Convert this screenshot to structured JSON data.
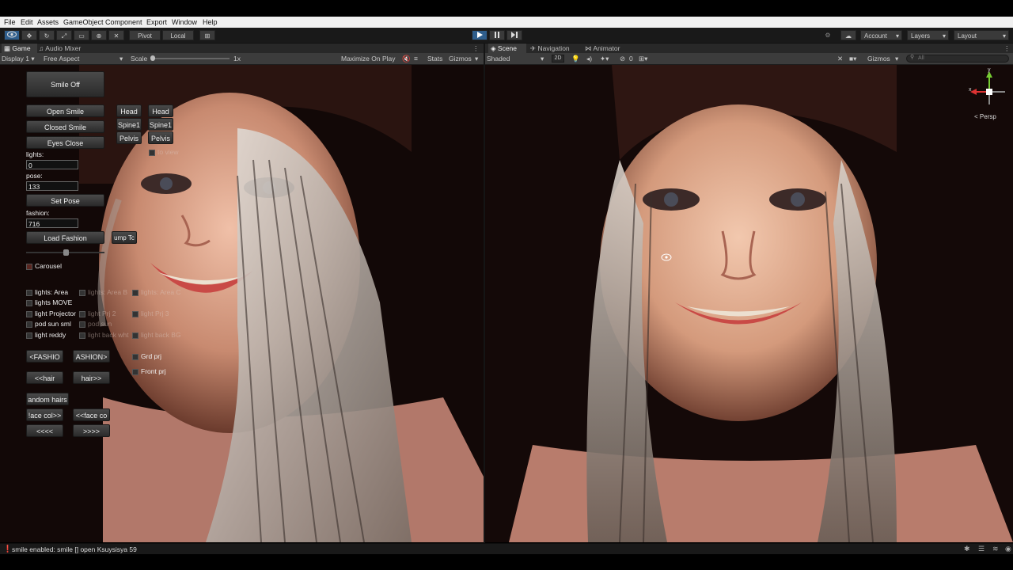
{
  "menu": [
    "File",
    "Edit",
    "Assets",
    "GameObject",
    "Component",
    "Export",
    "Window",
    "Help"
  ],
  "toolbar": {
    "pivot": "Pivot",
    "local": "Local",
    "account": "Account",
    "layers": "Layers",
    "layout": "Layout"
  },
  "game_tabs": [
    "Game",
    "Audio Mixer"
  ],
  "game_controls": {
    "display": "Display 1",
    "aspect": "Free Aspect",
    "scale_label": "Scale",
    "scale_value": "1x",
    "maximize": "Maximize On Play",
    "stats": "Stats",
    "gizmos": "Gizmos"
  },
  "scene_tabs": [
    "Scene",
    "Navigation",
    "Animator"
  ],
  "scene_controls": {
    "shading": "Shaded",
    "mode": "2D",
    "hidden_count": "0",
    "gizmos": "Gizmos",
    "search_placeholder": "All"
  },
  "gizmo": {
    "x": "x",
    "y": "y",
    "persp": "Persp"
  },
  "game_ui": {
    "smile_off": "Smile Off",
    "open_smile": "Open Smile",
    "closed_smile": "Closed Smile",
    "eyes_close": "Eyes Close",
    "lights_label": "lights:",
    "lights_value": "0",
    "pose_label": "pose:",
    "pose_value": "133",
    "set_pose": "Set Pose",
    "fashion_label": "fashion:",
    "fashion_value": "716",
    "load_fashion": "Load Fashion",
    "jump": "ump Tc",
    "bones_a": [
      "Head",
      "Spine1",
      "Pelvis"
    ],
    "bones_b": [
      "Head",
      "Spine1",
      "Pelvis"
    ],
    "to_view": "to view",
    "carousel": "Carousel",
    "lights_col1": [
      "lights: Area",
      "lights MOVE",
      "light Projector",
      "pod sun sml",
      "light reddy"
    ],
    "lights_col2": [
      "lights: Area B",
      "light Prj 2",
      "pod sun",
      "light back wht"
    ],
    "lights_col3": [
      "lights: Area C",
      "light Prj 3",
      "light back BG"
    ],
    "grd_prj": "Grd prj",
    "front_prj": "Front prj",
    "fashion_prev": "<FASHIO",
    "fashion_next": "ASHION>",
    "hair_prev": "<<hair",
    "hair_next": "hair>>",
    "random_hairs": "andom hairs",
    "face_col_next": "!ace col>>",
    "face_col_prev": "<<face co",
    "prev_all": "<<<<",
    "next_all": ">>>>"
  },
  "status": "smile enabled: smile [] open Ksuysisya 59"
}
